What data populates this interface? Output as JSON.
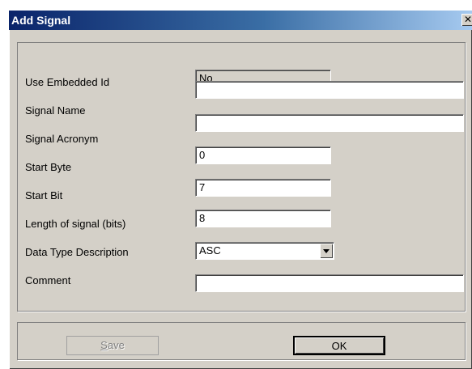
{
  "dialog": {
    "title": "Add Signal"
  },
  "fields": {
    "embedded_id": {
      "label": "Use Embedded Id",
      "value": "No"
    },
    "signal_name": {
      "label": "Signal Name",
      "value": ""
    },
    "signal_acronym": {
      "label": "Signal Acronym",
      "value": ""
    },
    "start_byte": {
      "label": "Start Byte",
      "value": "0"
    },
    "start_bit": {
      "label": "Start Bit",
      "value": "7"
    },
    "length": {
      "label": "Length of signal (bits)",
      "value": "8"
    },
    "data_type": {
      "label": "Data Type Description",
      "value": "ASC"
    },
    "comment": {
      "label": "Comment",
      "value": ""
    }
  },
  "buttons": {
    "save_first": "S",
    "save_rest": "ave",
    "ok": "OK"
  },
  "icons": {
    "close": "close-icon",
    "dropdown": "chevron-down-icon"
  },
  "colors": {
    "title_start": "#0a246a",
    "title_end": "#a6caf0",
    "face": "#d4d0c8"
  }
}
